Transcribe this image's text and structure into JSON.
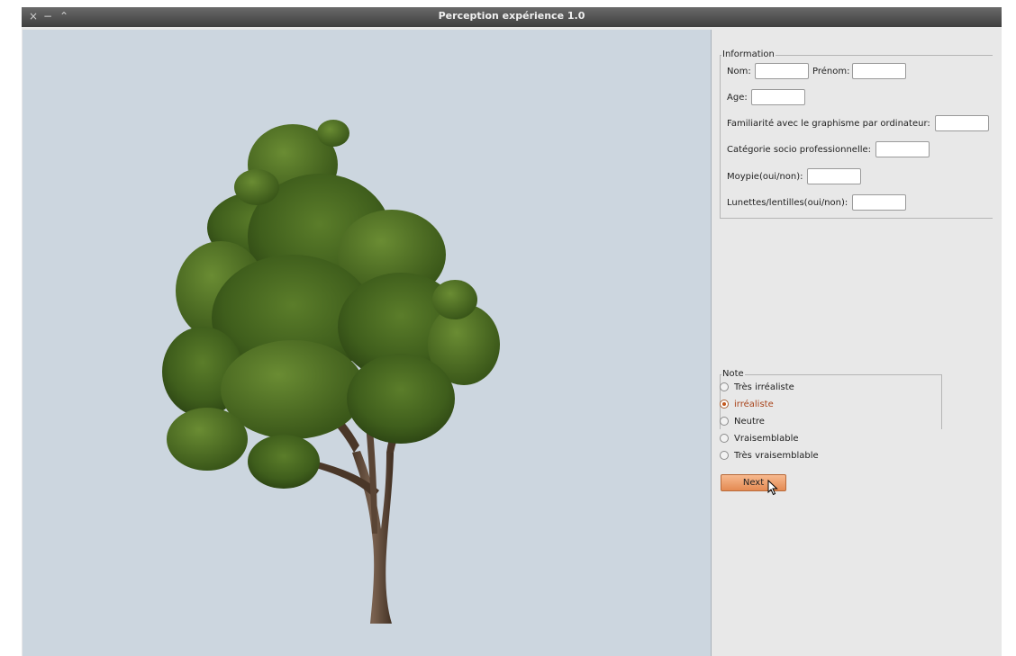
{
  "window": {
    "title": "Perception expérience 1.0",
    "controls": {
      "close": "×",
      "minimize": "−",
      "maximize": "⌃"
    }
  },
  "viewer": {
    "subject": "tree-3d-render",
    "background": "#ccd6df"
  },
  "information": {
    "legend": "Information",
    "nom_label": "Nom:",
    "prenom_label": "Prénom:",
    "age_label": "Age:",
    "familiarite_label": "Familiarité avec le graphisme par ordinateur:",
    "categorie_label": "Catégorie socio professionnelle:",
    "myopie_label": "Moypie(oui/non):",
    "lunettes_label": "Lunettes/lentilles(oui/non):",
    "nom_value": "",
    "prenom_value": "",
    "age_value": "",
    "familiarite_value": "",
    "categorie_value": "",
    "myopie_value": "",
    "lunettes_value": ""
  },
  "note": {
    "legend": "Note",
    "options": [
      "Très irréaliste",
      "irréaliste",
      "Neutre",
      "Vraisemblable",
      "Très vraisemblable"
    ],
    "selected_index": 1
  },
  "next_button": {
    "label": "Next"
  },
  "colors": {
    "accent": "#e48a52",
    "radio_selected": "#c2571c",
    "titlebar": "#4a4a4a"
  }
}
